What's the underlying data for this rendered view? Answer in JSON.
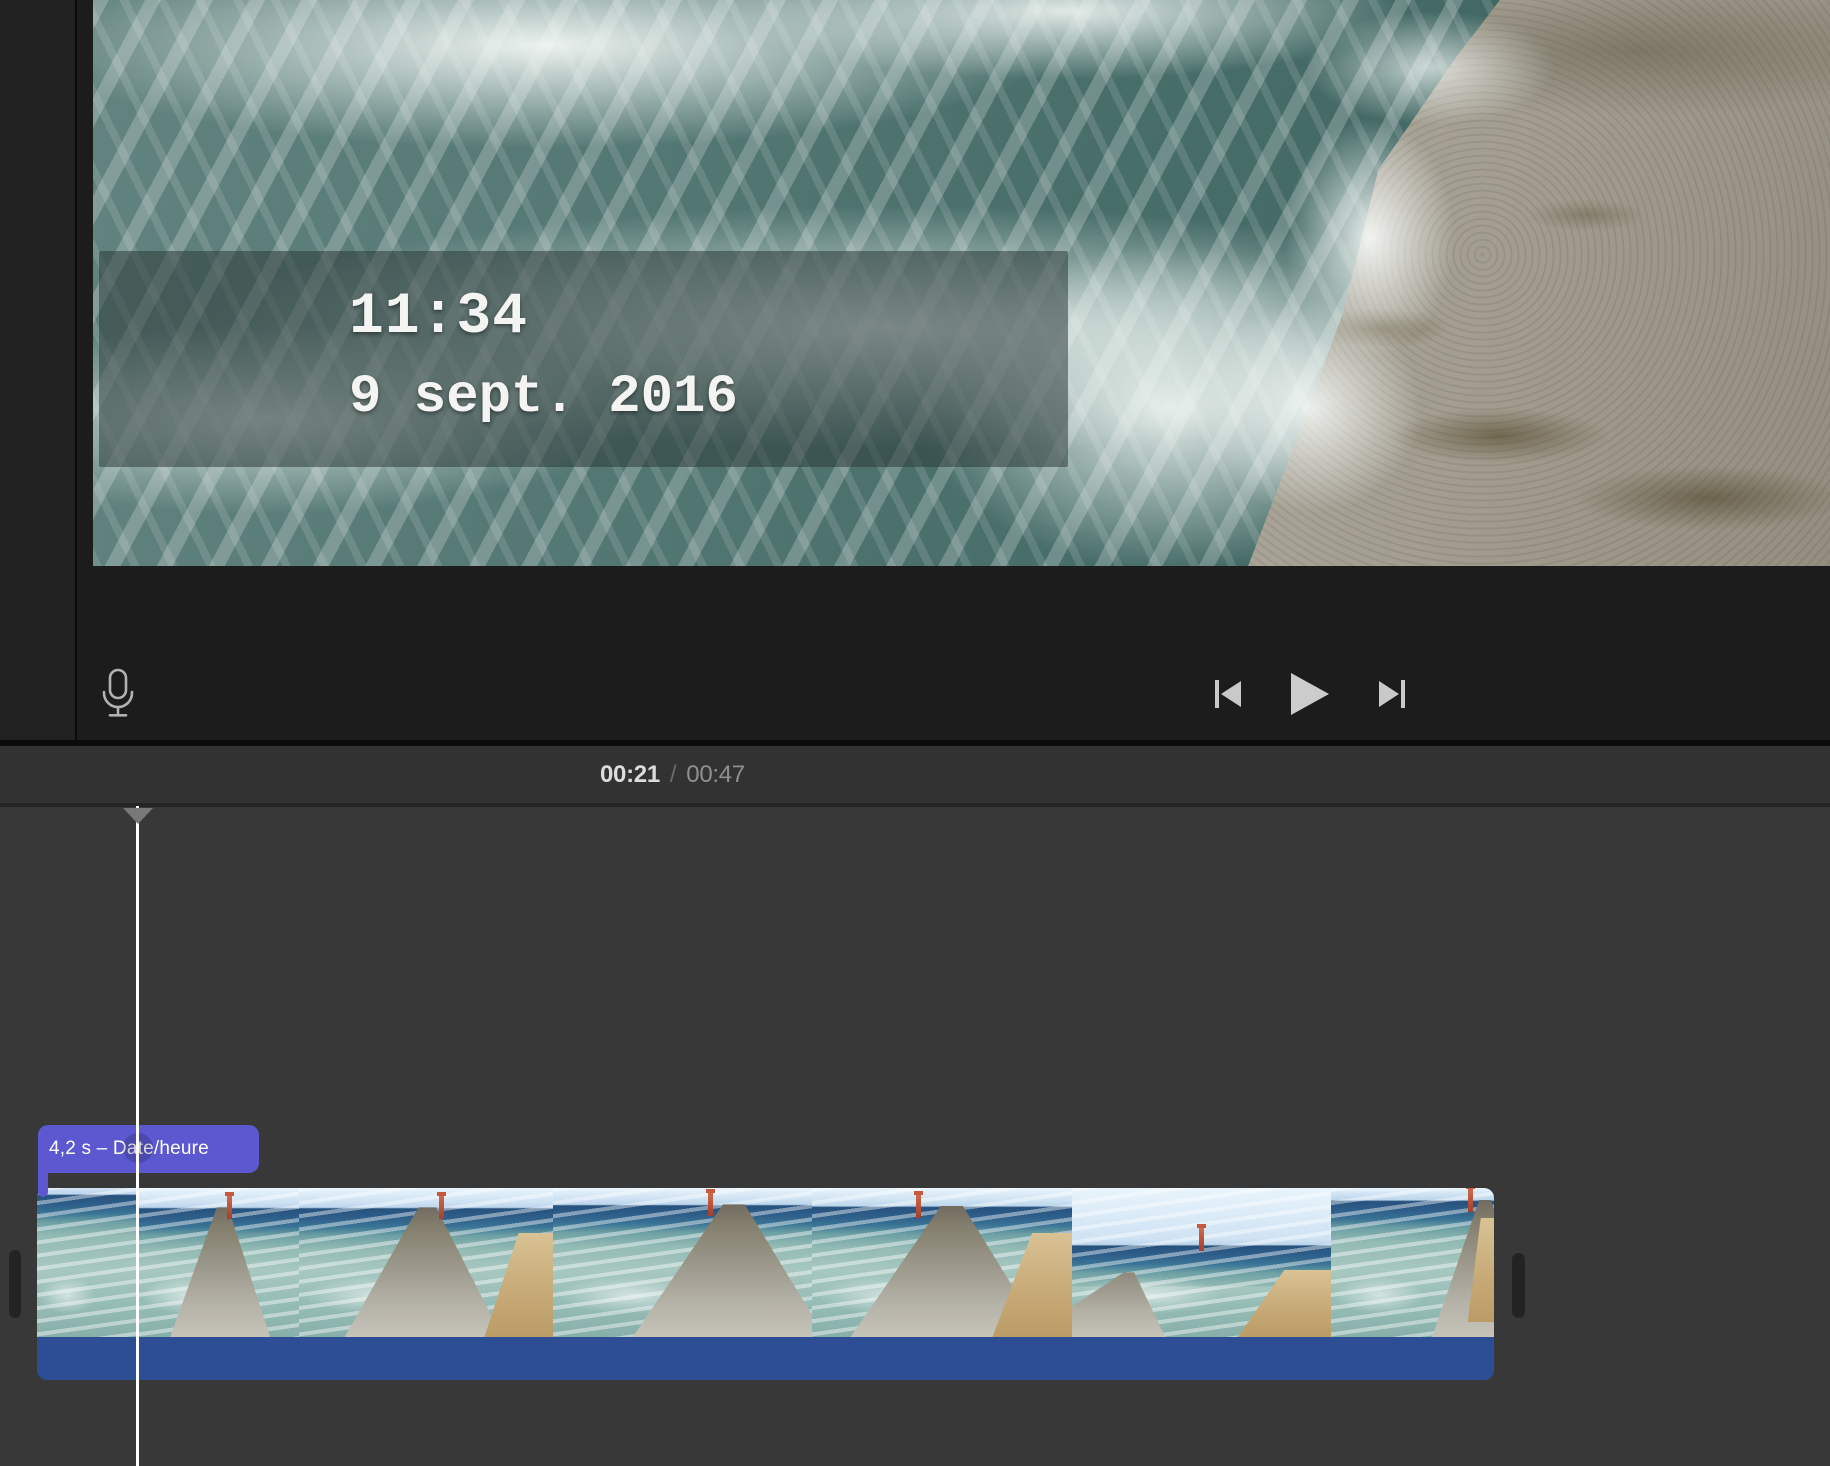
{
  "preview": {
    "title_overlay": {
      "time": "11:34",
      "date": "9 sept. 2016"
    },
    "icons": {
      "voiceover": "microphone-icon",
      "previous": "skip-to-start-icon",
      "play": "play-icon",
      "next": "skip-to-end-icon"
    }
  },
  "timecode_bar": {
    "current": "00:21",
    "separator": "/",
    "total": "00:47"
  },
  "timeline": {
    "title_clip": {
      "label": "4,2 s – Date/heure"
    },
    "video_clip": {
      "thumbnail_segments": 7,
      "has_audio_bar": true
    }
  },
  "colors": {
    "title_clip_purple": "#5b58d0",
    "audio_bar_blue": "#2d4d95",
    "playhead_white": "#ffffff",
    "timeline_background": "#383838",
    "viewer_background": "#1c1c1c",
    "timecode_current": "#dcdcdc",
    "timecode_total": "#8f8f8f"
  }
}
